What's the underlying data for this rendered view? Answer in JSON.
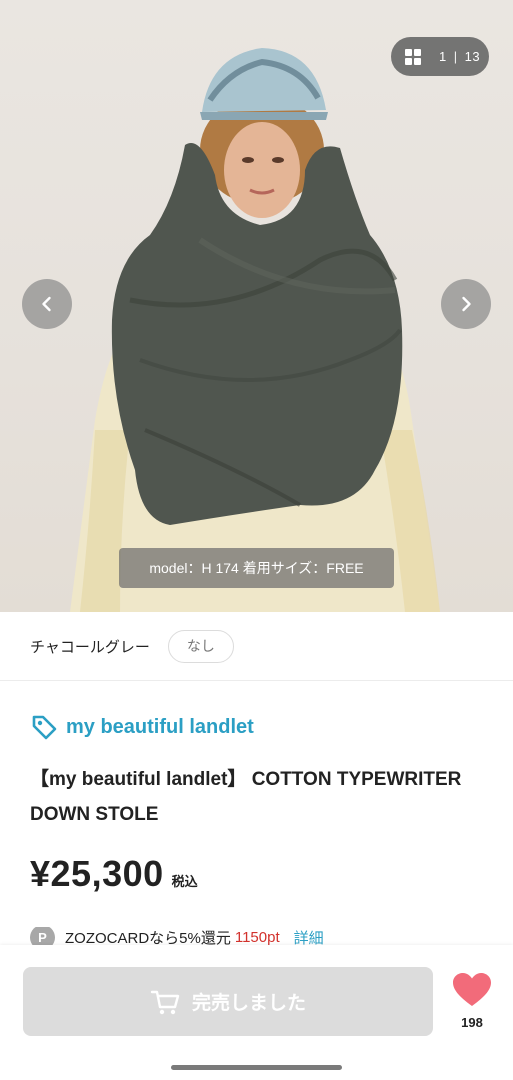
{
  "gallery": {
    "current": "1",
    "separator": "|",
    "total": "13",
    "caption": "model：H 174 着用サイズ：FREE",
    "grid_icon": "grid-icon",
    "prev_icon": "chevron-left-icon",
    "next_icon": "chevron-right-icon"
  },
  "color": {
    "name": "チャコールグレー",
    "stock": "なし"
  },
  "product": {
    "brand_icon": "tag-icon",
    "brand": "my beautiful landlet",
    "title": "【my beautiful landlet】 COTTON TYPEWRITER DOWN STOLE",
    "price": "¥25,300",
    "tax_label": "税込",
    "points_badge": "P",
    "points_text": "ZOZOCARDなら5%還元",
    "points_value": "1150pt",
    "points_link": "詳細"
  },
  "bottom": {
    "sold_label": "完売しました",
    "cart_icon": "cart-icon",
    "fav_icon": "heart-icon",
    "fav_count": "198"
  },
  "colors": {
    "brand": "#2b9fc4",
    "points": "#d2322d",
    "heart": "#f26b7a",
    "sold_button": "#dcdcdc"
  }
}
